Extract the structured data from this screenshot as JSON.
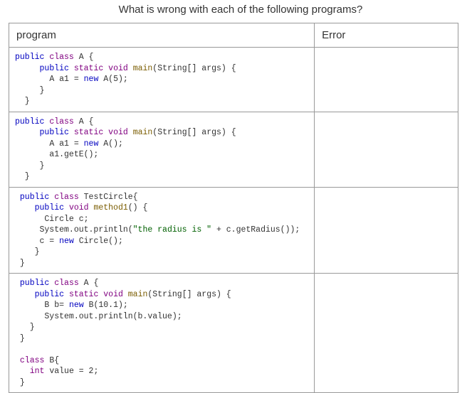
{
  "title": "What is wrong with each of the following programs?",
  "headers": {
    "program": "program",
    "error": "Error"
  },
  "code1": {
    "l1a": "public",
    "l1b": "class",
    "l1c": "A {",
    "l2a": "public",
    "l2b": "static",
    "l2c": "void",
    "l2d": "main",
    "l2e": "(String[] args) {",
    "l3a": "A a1 =",
    "l3b": "new",
    "l3c": "A(5);",
    "l4": "     }",
    "l5": "  }"
  },
  "code2": {
    "l1a": "public",
    "l1b": "class",
    "l1c": "A {",
    "l2a": "public",
    "l2b": "static",
    "l2c": "void",
    "l2d": "main",
    "l2e": "(String[] args) {",
    "l3a": "A a1 =",
    "l3b": "new",
    "l3c": "A();",
    "l4": "       a1.getE();",
    "l5": "     }",
    "l6": "  }"
  },
  "code3": {
    "l1a": "public",
    "l1b": "class",
    "l1c": "TestCircle{",
    "l2a": "public",
    "l2b": "void",
    "l2c": "method1",
    "l2d": "() {",
    "l3": "      Circle c;",
    "l4a": "     System.out.println(",
    "l4b": "\"the radius is \"",
    "l4c": " + c.getRadius());",
    "l5a": "     c =",
    "l5b": "new",
    "l5c": "Circle();",
    "l6": "    }",
    "l7": " }"
  },
  "code4": {
    "l1a": "public",
    "l1b": "class",
    "l1c": "A {",
    "l2a": "public",
    "l2b": "static",
    "l2c": "void",
    "l2d": "main",
    "l2e": "(String[] args) {",
    "l3a": "B b=",
    "l3b": "new",
    "l3c": "B(10.1);",
    "l4": "      System.out.println(b.value);",
    "l5": "   }",
    "l6": " }",
    "l7": "",
    "l8a": "class",
    "l8b": "B{",
    "l9a": "int",
    "l9b": "value = 2;",
    "l10": " }"
  }
}
